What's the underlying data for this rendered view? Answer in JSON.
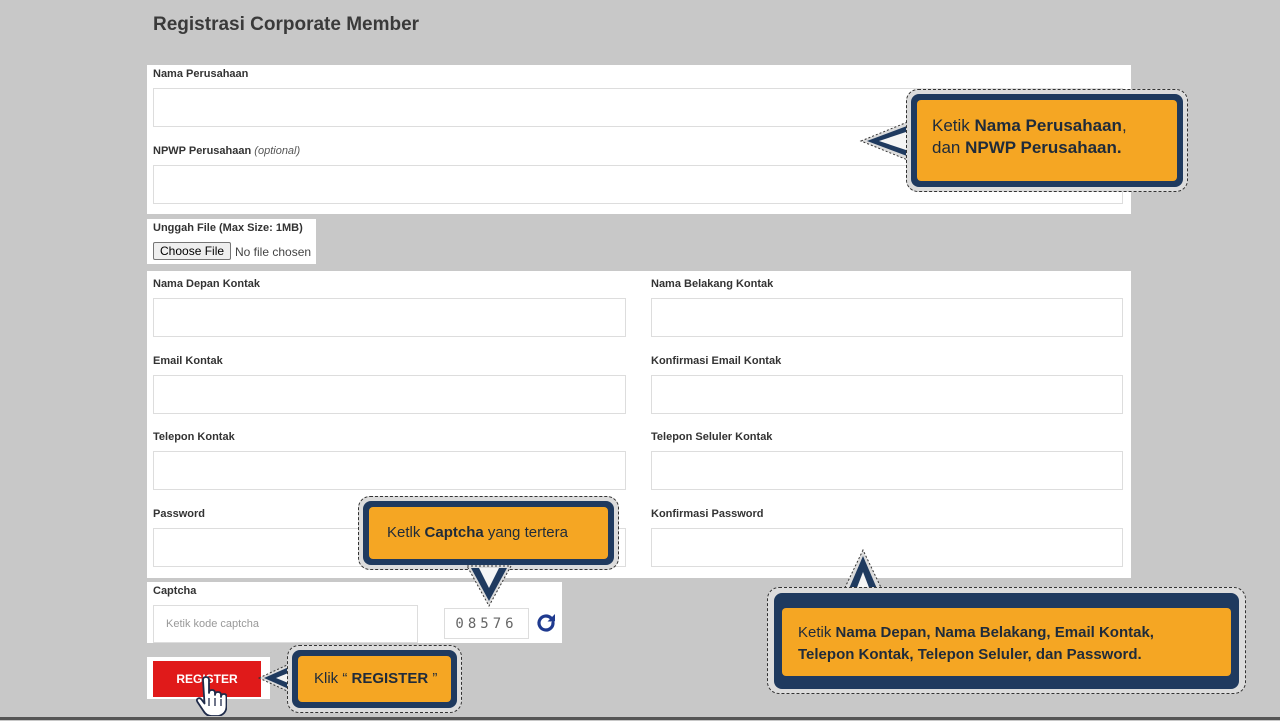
{
  "page": {
    "title": "Registrasi Corporate Member"
  },
  "company": {
    "name_label": "Nama Perusahaan",
    "npwp_label": "NPWP Perusahaan",
    "npwp_optional": "(optional)"
  },
  "upload": {
    "label": "Unggah File (Max Size: 1MB)",
    "button": "Choose File",
    "status": "No file chosen"
  },
  "contact": {
    "first_name_label": "Nama Depan Kontak",
    "last_name_label": "Nama Belakang Kontak",
    "email_label": "Email Kontak",
    "email_confirm_label": "Konfirmasi Email Kontak",
    "phone_label": "Telepon Kontak",
    "mobile_label": "Telepon Seluler Kontak",
    "password_label": "Password",
    "password_confirm_label": "Konfirmasi Password"
  },
  "captcha": {
    "label": "Captcha",
    "placeholder": "Ketik kode captcha",
    "code": "08576",
    "refresh_icon": "refresh-icon"
  },
  "register": {
    "label": "REGISTER"
  },
  "callouts": {
    "company": {
      "t1": "Ketik ",
      "b1": "Nama Perusahaan",
      "t2": ",",
      "t3": "dan ",
      "b2": "NPWP Perusahaan."
    },
    "captcha": {
      "t1": "Ketlk ",
      "b1": "Captcha",
      "t2": " yang tertera"
    },
    "register": {
      "t1": "Klik “ ",
      "b1": "REGISTER",
      "t2": " ”"
    },
    "contact": {
      "t1": "Ketik ",
      "b1": "Nama Depan, Nama  Belakang, Email Kontak,",
      "b2": "Telepon Kontak, Telepon Seluler, dan Password."
    }
  },
  "colors": {
    "accent": "#f5a623",
    "navy": "#1f3a5f",
    "register_red": "#e01a1a"
  }
}
